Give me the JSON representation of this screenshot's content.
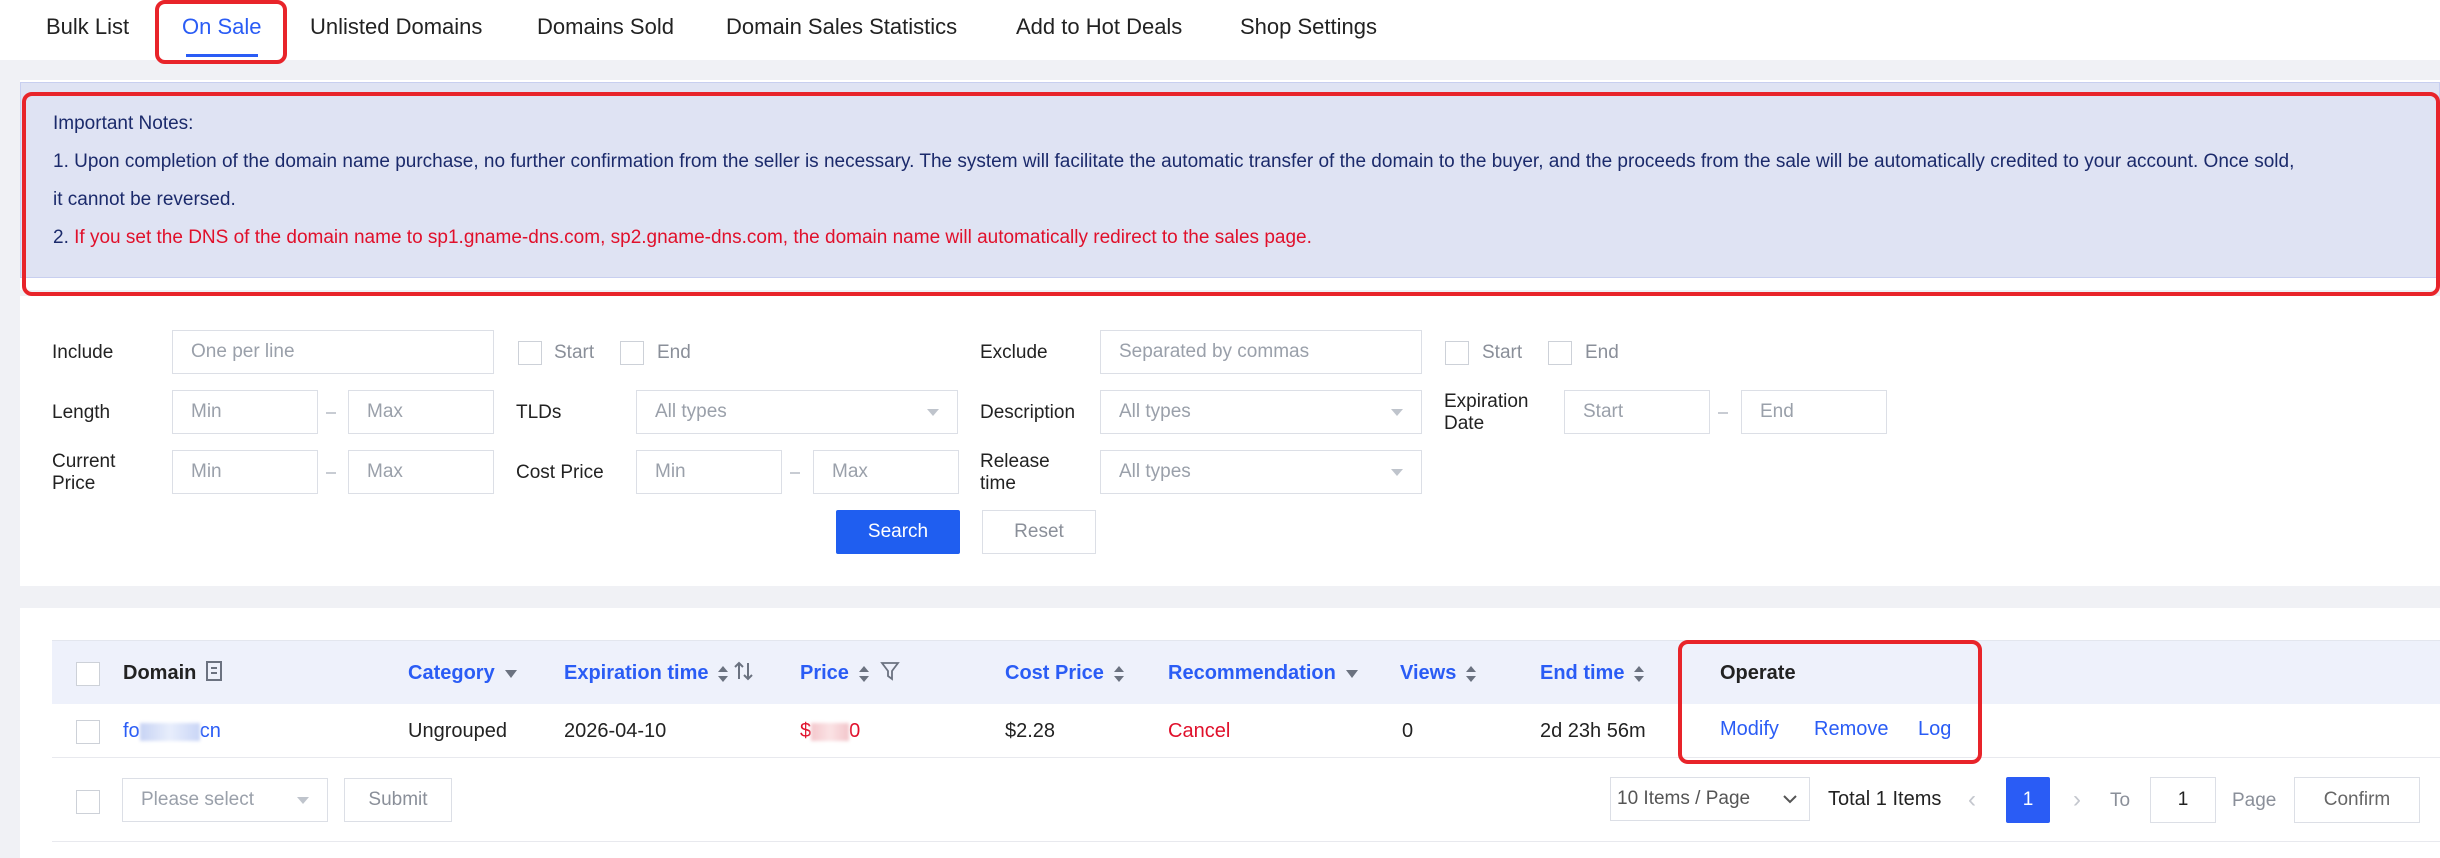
{
  "tabs": [
    {
      "label": "Bulk List",
      "active": false
    },
    {
      "label": "On Sale",
      "active": true
    },
    {
      "label": "Unlisted Domains",
      "active": false
    },
    {
      "label": "Domains Sold",
      "active": false
    },
    {
      "label": "Domain Sales Statistics",
      "active": false
    },
    {
      "label": "Add to Hot Deals",
      "active": false
    },
    {
      "label": "Shop Settings",
      "active": false
    }
  ],
  "notice": {
    "title": "Important Notes:",
    "line1a": "1. Upon completion of the domain name purchase, no further confirmation from the seller is necessary. The system will facilitate the automatic transfer of the domain to the buyer, and the proceeds from the sale will be automatically credited to your account. Once sold,",
    "line1b": "it cannot be reversed.",
    "line2_prefix": "2. ",
    "line2_red": "If you set the DNS of the domain name to sp1.gname-dns.com, sp2.gname-dns.com, the domain name will automatically redirect to the sales page."
  },
  "filters": {
    "include_label": "Include",
    "include_placeholder": "One per line",
    "start_label": "Start",
    "end_label": "End",
    "exclude_label": "Exclude",
    "exclude_placeholder": "Separated by commas",
    "length_label": "Length",
    "min_placeholder": "Min",
    "max_placeholder": "Max",
    "tlds_label": "TLDs",
    "all_types": "All types",
    "description_label": "Description",
    "expiration_label_1": "Expiration",
    "expiration_label_2": "Date",
    "start_placeholder": "Start",
    "end_placeholder": "End",
    "current_price_label_1": "Current",
    "current_price_label_2": "Price",
    "cost_price_label": "Cost Price",
    "release_label_1": "Release",
    "release_label_2": "time",
    "search_button": "Search",
    "reset_button": "Reset"
  },
  "table": {
    "headers": {
      "domain": "Domain",
      "category": "Category",
      "expiration_time": "Expiration time",
      "price": "Price",
      "cost_price": "Cost Price",
      "recommendation": "Recommendation",
      "views": "Views",
      "end_time": "End time",
      "operate": "Operate"
    },
    "rows": [
      {
        "domain_prefix": "fo",
        "domain_suffix": "cn",
        "category": "Ungrouped",
        "expiration_time": "2026-04-10",
        "price_prefix": "$",
        "price_suffix": "0",
        "cost_price": "$2.28",
        "recommendation": "Cancel",
        "views": "0",
        "end_time": "2d 23h 56m",
        "actions": {
          "modify": "Modify",
          "remove": "Remove",
          "log": "Log"
        }
      }
    ],
    "footer": {
      "bulk_select_placeholder": "Please select",
      "submit_button": "Submit",
      "page_size": "10 Items / Page",
      "total": "Total 1 Items",
      "current_page": "1",
      "to_label": "To",
      "goto_value": "1",
      "page_label": "Page",
      "confirm_button": "Confirm"
    }
  },
  "colors": {
    "accent": "#2a5cf5",
    "highlight": "#e8242a",
    "notice_bg": "#dfe3f3"
  }
}
